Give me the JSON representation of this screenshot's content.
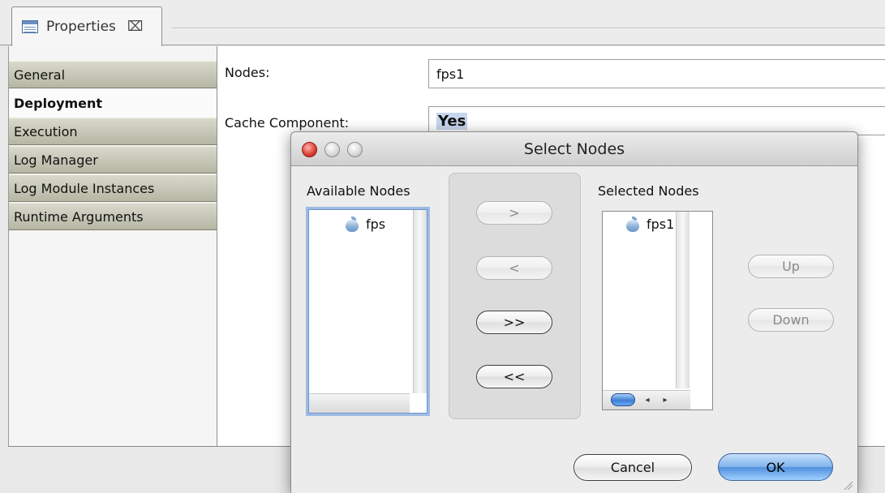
{
  "view": {
    "tab_label": "Properties",
    "tab_close_glyph": "⌧"
  },
  "sidebar": {
    "items": [
      {
        "label": "General",
        "active": false
      },
      {
        "label": "Deployment",
        "active": true
      },
      {
        "label": "Execution",
        "active": false
      },
      {
        "label": "Log Manager",
        "active": false
      },
      {
        "label": "Log Module Instances",
        "active": false
      },
      {
        "label": "Runtime Arguments",
        "active": false
      }
    ]
  },
  "form": {
    "nodes_label": "Nodes:",
    "nodes_value": "fps1",
    "cache_label": "Cache Component:",
    "cache_value": "Yes"
  },
  "dialog": {
    "title": "Select Nodes",
    "available_label": "Available Nodes",
    "available_items": [
      "fps"
    ],
    "selected_label": "Selected Nodes",
    "selected_items": [
      "fps1"
    ],
    "move_buttons": {
      "add": ">",
      "remove": "<",
      "add_all": ">>",
      "remove_all": "<<"
    },
    "up_label": "Up",
    "down_label": "Down",
    "cancel_label": "Cancel",
    "ok_label": "OK",
    "scroll_left_glyph": "◂",
    "scroll_right_glyph": "▸"
  },
  "colors": {
    "sidebar_item": "#c8c8b8",
    "default_button": "#5b9be4",
    "close_light": "#e0443a"
  }
}
